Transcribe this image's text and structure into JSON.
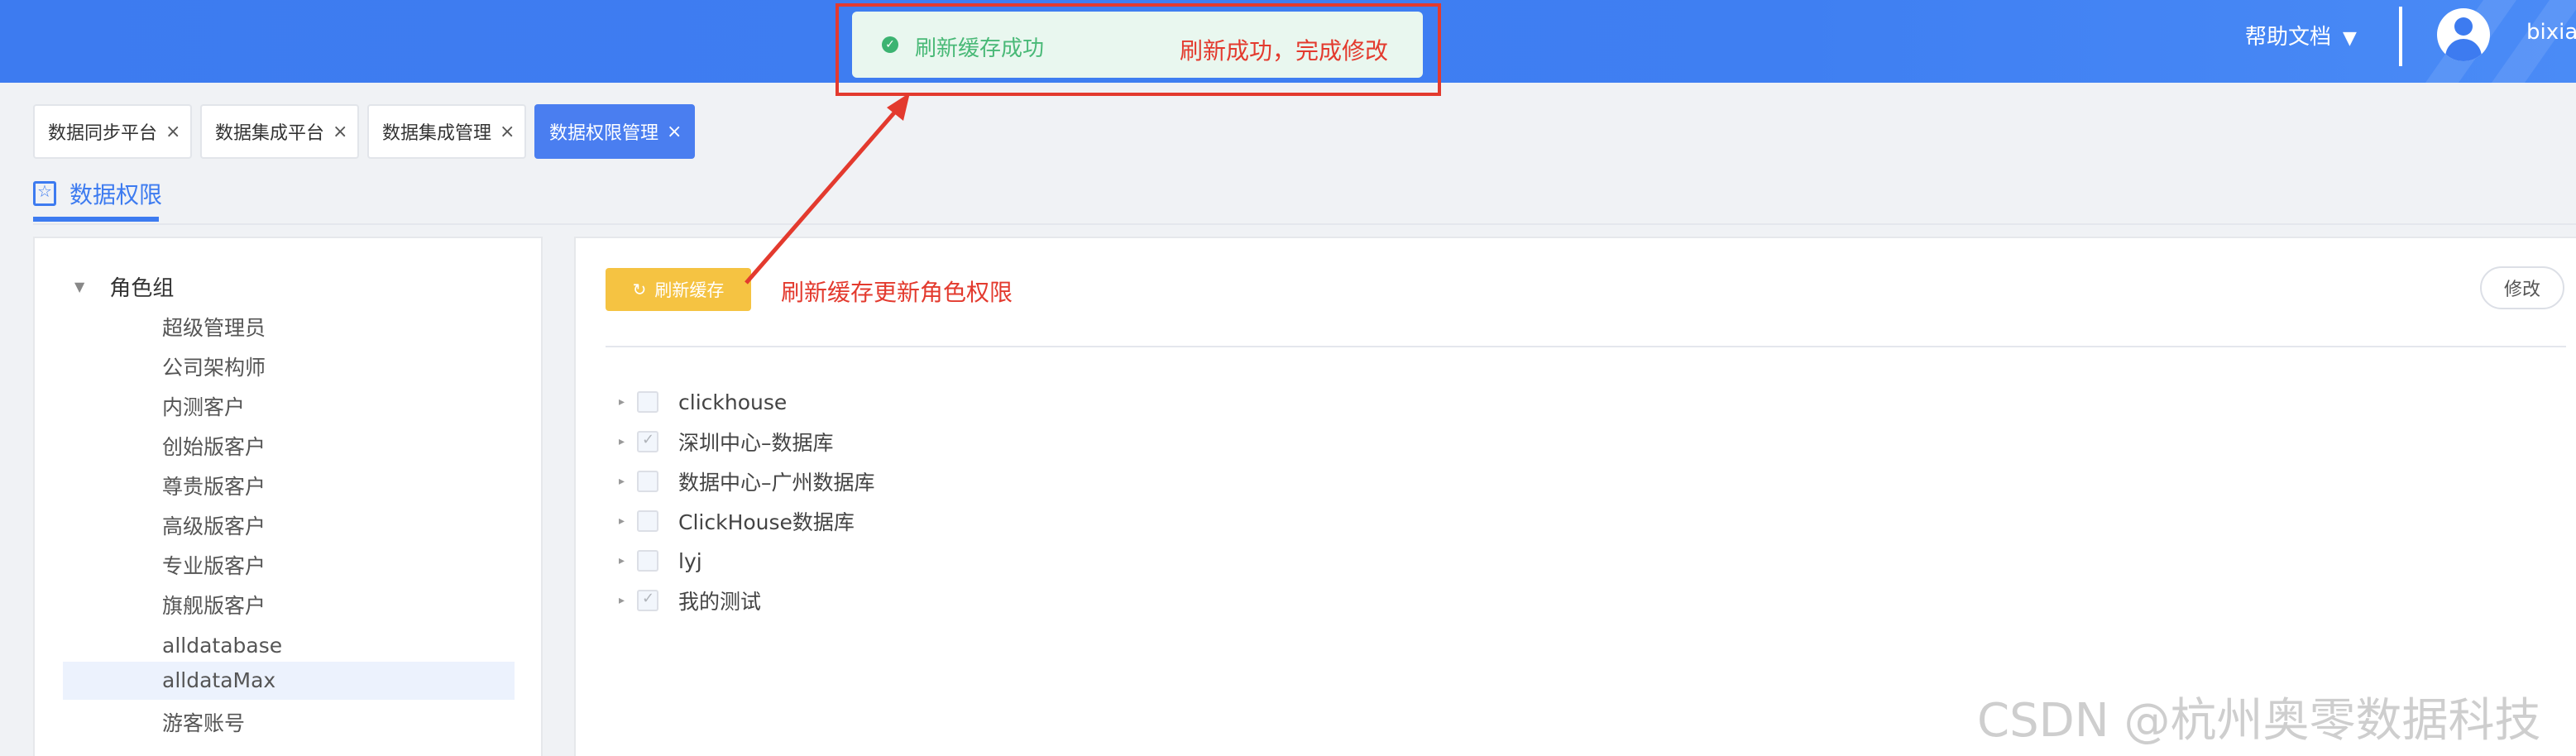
{
  "header": {
    "help_label": "帮助文档",
    "help_caret": "▼",
    "username": "bixian",
    "avatar_icon": "user-avatar-icon"
  },
  "toast": {
    "message": "刷新缓存成功",
    "icon": "check-circle-icon"
  },
  "annotations": {
    "toast_note": "刷新成功，完成修改",
    "button_note": "刷新缓存更新角色权限"
  },
  "tabs": [
    {
      "label": "数据同步平台",
      "active": false
    },
    {
      "label": "数据集成平台",
      "active": false
    },
    {
      "label": "数据集成管理",
      "active": false
    },
    {
      "label": "数据权限管理",
      "active": true
    }
  ],
  "tab_close": "×",
  "page": {
    "title": "数据权限",
    "title_icon": "star-doc-icon"
  },
  "role_tree": {
    "root": "角色组",
    "root_arrow": "▼",
    "items": [
      "超级管理员",
      "公司架构师",
      "内测客户",
      "创始版客户",
      "尊贵版客户",
      "高级版客户",
      "专业版客户",
      "旗舰版客户",
      "alldatabase",
      "alldataMax",
      "游客账号"
    ],
    "selected": "alldataMax"
  },
  "toolbar": {
    "refresh_label": "刷新缓存",
    "refresh_icon": "↻",
    "edit_label": "修改"
  },
  "permissions": {
    "expand_icon": "▸",
    "items": [
      {
        "label": "clickhouse",
        "checked": false
      },
      {
        "label": "深圳中心–数据库",
        "checked": true
      },
      {
        "label": "数据中心–广州数据库",
        "checked": false
      },
      {
        "label": "ClickHouse数据库",
        "checked": false
      },
      {
        "label": "lyj",
        "checked": false
      },
      {
        "label": "我的测试",
        "checked": true
      }
    ]
  },
  "watermark": "CSDN @杭州奥零数据科技",
  "colors": {
    "header_blue": "#3d7bf0",
    "accent_blue": "#4a7ef0",
    "toast_green": "#49b977",
    "annotation_red": "#e33a2e",
    "refresh_yellow": "#f5c342"
  }
}
